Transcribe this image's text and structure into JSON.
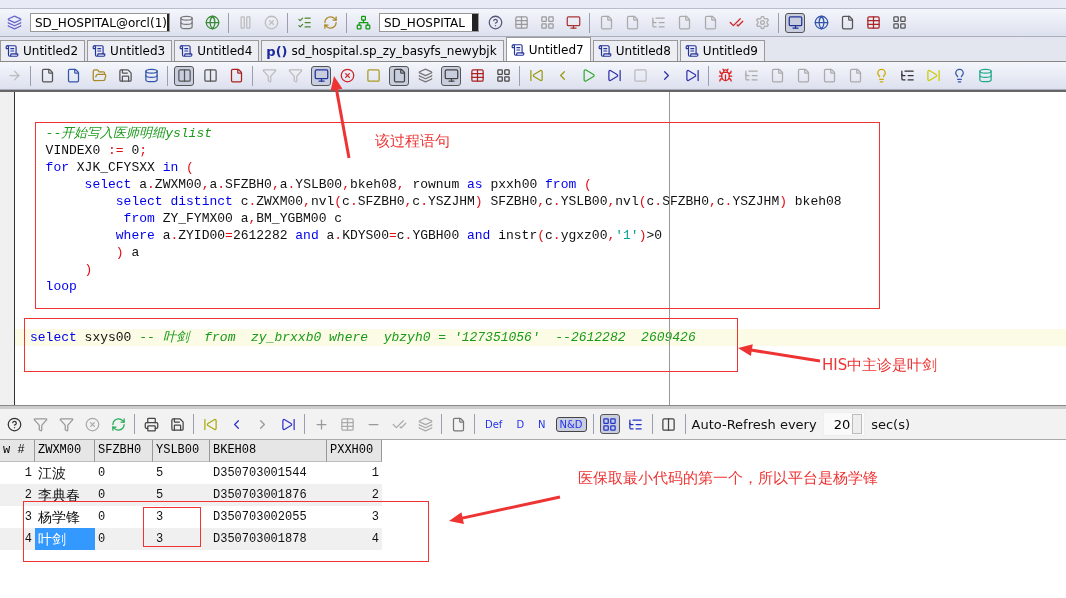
{
  "toolbar": {
    "connection": "SD_HOSPITAL@orcl(1)",
    "schema": "SD_HOSPITAL"
  },
  "tabs": [
    {
      "label": "Untitled2",
      "kind": "sql",
      "selected": false
    },
    {
      "label": "Untitled3",
      "kind": "sql",
      "selected": false
    },
    {
      "label": "Untitled4",
      "kind": "sql",
      "selected": false
    },
    {
      "label": "sd_hospital.sp_zy_basyfs_newybjk",
      "kind": "proc",
      "icon_text": "p()",
      "selected": false
    },
    {
      "label": "Untitled7",
      "kind": "sql",
      "selected": true
    },
    {
      "label": "Untitled8",
      "kind": "sql",
      "selected": false
    },
    {
      "label": "Untitled9",
      "kind": "sql",
      "selected": false
    }
  ],
  "editor": {
    "lines": [
      [
        {
          "kind": "comment",
          "text": "  --开始写入医师明细yslist"
        }
      ],
      [
        {
          "kind": "ident",
          "text": "  VINDEX0 "
        },
        {
          "kind": "op",
          "text": ":="
        },
        {
          "kind": "ident",
          "text": " 0"
        },
        {
          "kind": "op",
          "text": ";"
        }
      ],
      [
        {
          "kind": "keyword",
          "text": "  for"
        },
        {
          "kind": "ident",
          "text": " XJK_CFYSXX "
        },
        {
          "kind": "keyword",
          "text": "in"
        },
        {
          "kind": "op",
          "text": " ("
        }
      ],
      [
        {
          "kind": "keyword",
          "text": "       select"
        },
        {
          "kind": "ident",
          "text": " a"
        },
        {
          "kind": "op",
          "text": "."
        },
        {
          "kind": "ident",
          "text": "ZWXM00"
        },
        {
          "kind": "op",
          "text": ","
        },
        {
          "kind": "ident",
          "text": "a"
        },
        {
          "kind": "op",
          "text": "."
        },
        {
          "kind": "ident",
          "text": "SFZBH0"
        },
        {
          "kind": "op",
          "text": ","
        },
        {
          "kind": "ident",
          "text": "a"
        },
        {
          "kind": "op",
          "text": "."
        },
        {
          "kind": "ident",
          "text": "YSLB00"
        },
        {
          "kind": "op",
          "text": ","
        },
        {
          "kind": "ident",
          "text": "bkeh08"
        },
        {
          "kind": "op",
          "text": ","
        },
        {
          "kind": "ident",
          "text": " rownum "
        },
        {
          "kind": "keyword",
          "text": "as"
        },
        {
          "kind": "ident",
          "text": " pxxh00 "
        },
        {
          "kind": "keyword",
          "text": "from"
        },
        {
          "kind": "op",
          "text": " ("
        }
      ],
      [
        {
          "kind": "keyword",
          "text": "           select distinct"
        },
        {
          "kind": "ident",
          "text": " c"
        },
        {
          "kind": "op",
          "text": "."
        },
        {
          "kind": "ident",
          "text": "ZWXM00"
        },
        {
          "kind": "op",
          "text": ","
        },
        {
          "kind": "ident",
          "text": "nvl"
        },
        {
          "kind": "op",
          "text": "("
        },
        {
          "kind": "ident",
          "text": "c"
        },
        {
          "kind": "op",
          "text": "."
        },
        {
          "kind": "ident",
          "text": "SFZBH0"
        },
        {
          "kind": "op",
          "text": ","
        },
        {
          "kind": "ident",
          "text": "c"
        },
        {
          "kind": "op",
          "text": "."
        },
        {
          "kind": "ident",
          "text": "YSZJHM"
        },
        {
          "kind": "op",
          "text": ")"
        },
        {
          "kind": "ident",
          "text": " SFZBH0"
        },
        {
          "kind": "op",
          "text": ","
        },
        {
          "kind": "ident",
          "text": "c"
        },
        {
          "kind": "op",
          "text": "."
        },
        {
          "kind": "ident",
          "text": "YSLB00"
        },
        {
          "kind": "op",
          "text": ","
        },
        {
          "kind": "ident",
          "text": "nvl"
        },
        {
          "kind": "op",
          "text": "("
        },
        {
          "kind": "ident",
          "text": "c"
        },
        {
          "kind": "op",
          "text": "."
        },
        {
          "kind": "ident",
          "text": "SFZBH0"
        },
        {
          "kind": "op",
          "text": ","
        },
        {
          "kind": "ident",
          "text": "c"
        },
        {
          "kind": "op",
          "text": "."
        },
        {
          "kind": "ident",
          "text": "YSZJHM"
        },
        {
          "kind": "op",
          "text": ")"
        },
        {
          "kind": "ident",
          "text": " bkeh08"
        }
      ],
      [
        {
          "kind": "keyword",
          "text": "            from"
        },
        {
          "kind": "ident",
          "text": " ZY_FYMX00 a"
        },
        {
          "kind": "op",
          "text": ","
        },
        {
          "kind": "ident",
          "text": "BM_YGBM00 c"
        }
      ],
      [
        {
          "kind": "keyword",
          "text": "           where"
        },
        {
          "kind": "ident",
          "text": " a"
        },
        {
          "kind": "op",
          "text": "."
        },
        {
          "kind": "ident",
          "text": "ZYID00"
        },
        {
          "kind": "op",
          "text": "="
        },
        {
          "kind": "ident",
          "text": "2612282 "
        },
        {
          "kind": "keyword",
          "text": "and"
        },
        {
          "kind": "ident",
          "text": " a"
        },
        {
          "kind": "op",
          "text": "."
        },
        {
          "kind": "ident",
          "text": "KDYS00"
        },
        {
          "kind": "op",
          "text": "="
        },
        {
          "kind": "ident",
          "text": "c"
        },
        {
          "kind": "op",
          "text": "."
        },
        {
          "kind": "ident",
          "text": "YGBH00 "
        },
        {
          "kind": "keyword",
          "text": "and"
        },
        {
          "kind": "ident",
          "text": " instr"
        },
        {
          "kind": "op",
          "text": "("
        },
        {
          "kind": "ident",
          "text": "c"
        },
        {
          "kind": "op",
          "text": "."
        },
        {
          "kind": "ident",
          "text": "ygxz00"
        },
        {
          "kind": "op",
          "text": ","
        },
        {
          "kind": "string",
          "text": "'1'"
        },
        {
          "kind": "op",
          "text": ")"
        },
        {
          "kind": "ident",
          "text": ">0"
        }
      ],
      [
        {
          "kind": "op",
          "text": "           )"
        },
        {
          "kind": "ident",
          "text": " a"
        }
      ],
      [
        {
          "kind": "op",
          "text": "       )"
        }
      ],
      [
        {
          "kind": "keyword",
          "text": "  loop"
        }
      ]
    ],
    "current_line": [
      {
        "kind": "keyword",
        "text": "select"
      },
      {
        "kind": "ident",
        "text": " sxys00 "
      },
      {
        "kind": "comment",
        "text": "-- 叶剑  from  zy_brxxb0 where  ybzyh0 = '127351056'  --2612282  2609426"
      }
    ]
  },
  "results_toolbar": {
    "join_buttons": [
      {
        "label": "Def",
        "pressed": false
      },
      {
        "label": "D",
        "pressed": false
      },
      {
        "label": "N",
        "pressed": false
      },
      {
        "label": "N&D",
        "pressed": true
      }
    ],
    "auto_refresh_label": "Auto-Refresh every",
    "interval": "20",
    "unit": "sec(s)"
  },
  "grid": {
    "columns": [
      "w #",
      "ZWXM00",
      "SFZBH0",
      "YSLB00",
      "BKEH08",
      "PXXH00"
    ],
    "rows": [
      {
        "cells": [
          "1",
          "江波",
          "0",
          "5",
          "D350703001544",
          "1"
        ],
        "selected": false
      },
      {
        "cells": [
          "2",
          "李典春",
          "0",
          "5",
          "D350703001876",
          "2"
        ],
        "selected": false
      },
      {
        "cells": [
          "3",
          "杨学锋",
          "0",
          "3",
          "D350703002055",
          "3"
        ],
        "selected": false
      },
      {
        "cells": [
          "4",
          "叶剑",
          "0",
          "3",
          "D350703001878",
          "4"
        ],
        "selected": true
      }
    ]
  },
  "annotations": [
    "该过程语句",
    "HIS中主诊是叶剑",
    "医保取最小代码的第一个，所以平台是杨学锋"
  ]
}
